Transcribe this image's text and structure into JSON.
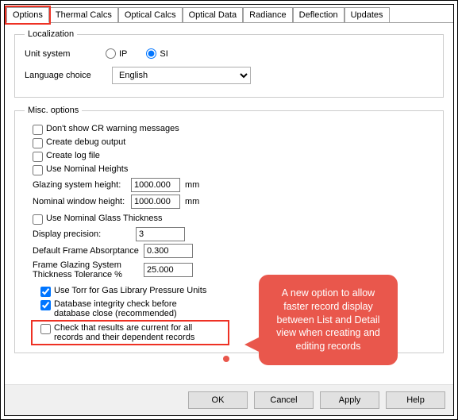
{
  "tabs": [
    "Options",
    "Thermal Calcs",
    "Optical Calcs",
    "Optical Data",
    "Radiance",
    "Deflection",
    "Updates"
  ],
  "activeTab": 0,
  "localization": {
    "legend": "Localization",
    "unit_label": "Unit system",
    "ip": "IP",
    "si": "SI",
    "lang_label": "Language choice",
    "lang_value": "English"
  },
  "misc": {
    "legend": "Misc. options",
    "cr_warning": "Don't show CR warning messages",
    "debug": "Create debug output",
    "logfile": "Create log file",
    "nominal_heights": "Use Nominal Heights",
    "glazing_h_label": "Glazing system height:",
    "glazing_h": "1000.000",
    "mm": "mm",
    "window_h_label": "Nominal window height:",
    "window_h": "1000.000",
    "nominal_glass": "Use Nominal Glass Thickness",
    "disp_prec_label": "Display precision:",
    "disp_prec": "3",
    "frame_abs_label": "Default Frame Absorptance",
    "frame_abs": "0.300",
    "thick_tol_label": "Frame Glazing System Thickness Tolerance %",
    "thick_tol": "25.000",
    "torr": "Use Torr for Gas Library Pressure Units",
    "db_integrity": "Database integrity check before database close (recommended)",
    "check_results": "Check that results are current for all records and their dependent records"
  },
  "callout": "A new option to allow faster record display between List and Detail view when creating and editing records",
  "buttons": {
    "ok": "OK",
    "cancel": "Cancel",
    "apply": "Apply",
    "help": "Help"
  }
}
